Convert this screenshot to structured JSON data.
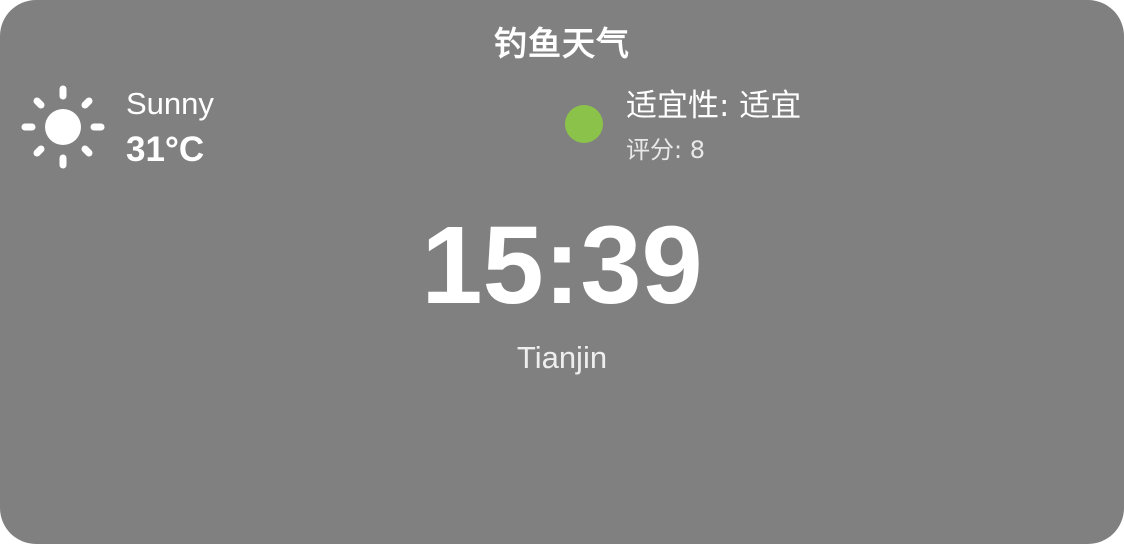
{
  "widget": {
    "title": "钓鱼天气",
    "background_color": "#808080"
  },
  "weather": {
    "icon": "sun-icon",
    "condition": "Sunny",
    "temperature": "31°C"
  },
  "fishing": {
    "suitability_text": "适宜性: 适宜",
    "score_text": "评分: 8",
    "status_color": "#8bc34a"
  },
  "clock": {
    "time": "15:39"
  },
  "location": {
    "city": "Tianjin"
  }
}
